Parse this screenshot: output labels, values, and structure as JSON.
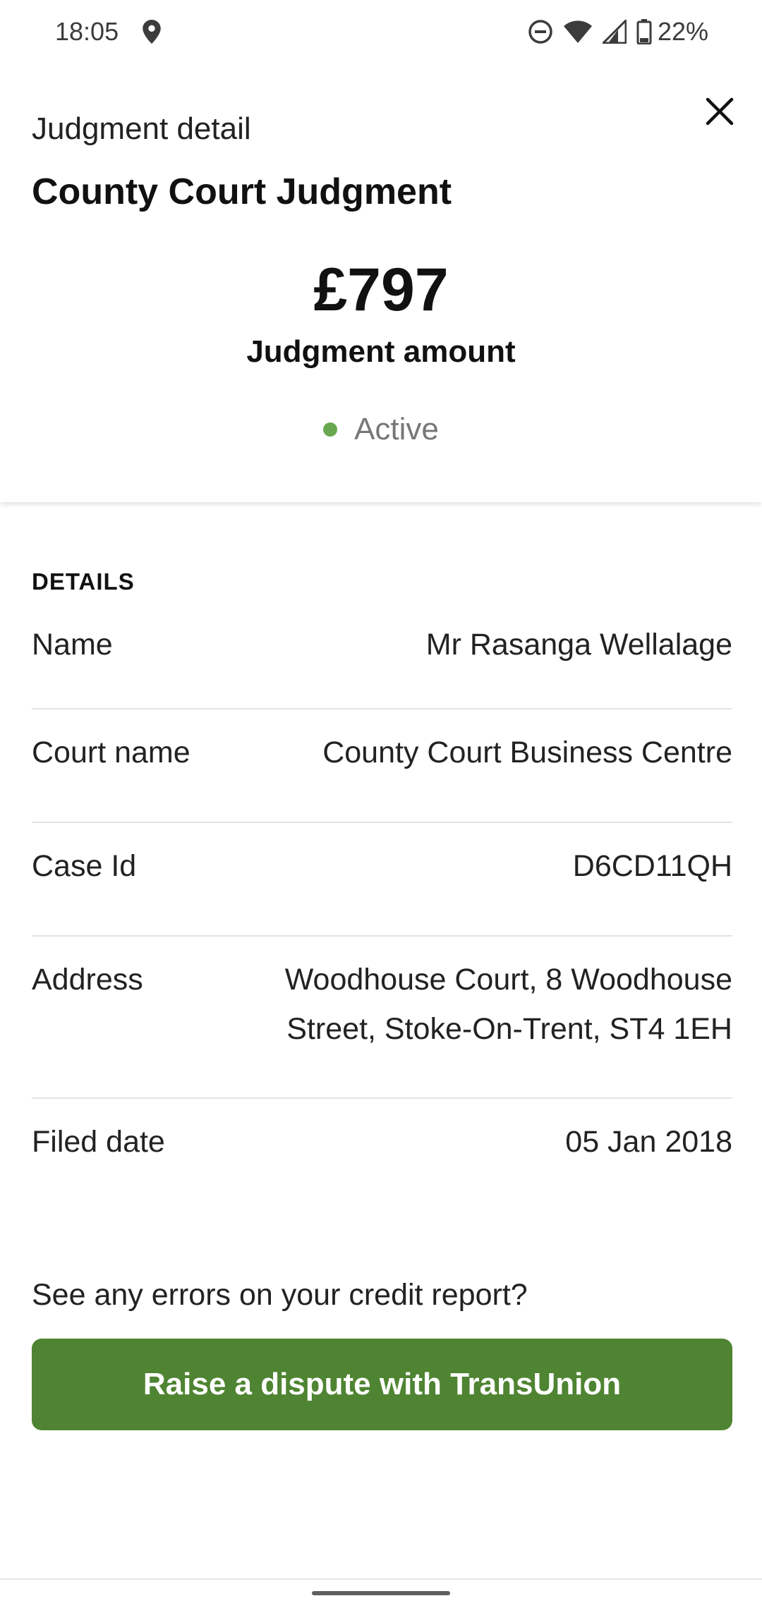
{
  "status_bar": {
    "time": "18:05",
    "location_icon": "location-pin-icon",
    "dnd_icon": "do-not-disturb-icon",
    "wifi_icon": "wifi-icon",
    "signal_icon": "cellular-signal-icon",
    "battery_icon": "battery-icon",
    "battery": "22%"
  },
  "header": {
    "label": "Judgment detail",
    "title": "County Court Judgment",
    "amount": "£797",
    "amount_label": "Judgment amount",
    "status": "Active",
    "status_color": "#6aa84f",
    "close_icon": "close-icon"
  },
  "details": {
    "heading": "DETAILS",
    "rows": [
      {
        "label": "Name",
        "value": "Mr Rasanga Wellalage"
      },
      {
        "label": "Court name",
        "value": "County Court Business Centre"
      },
      {
        "label": "Case Id",
        "value": "D6CD11QH"
      },
      {
        "label": "Address",
        "value": "Woodhouse Court, 8 Woodhouse Street, Stoke-On-Trent, ST4 1EH"
      },
      {
        "label": "Filed date",
        "value": "05 Jan 2018"
      }
    ]
  },
  "footer": {
    "errors_text": "See any errors on your credit report?",
    "dispute_button": "Raise a dispute with TransUnion",
    "button_color": "#4f8432"
  }
}
